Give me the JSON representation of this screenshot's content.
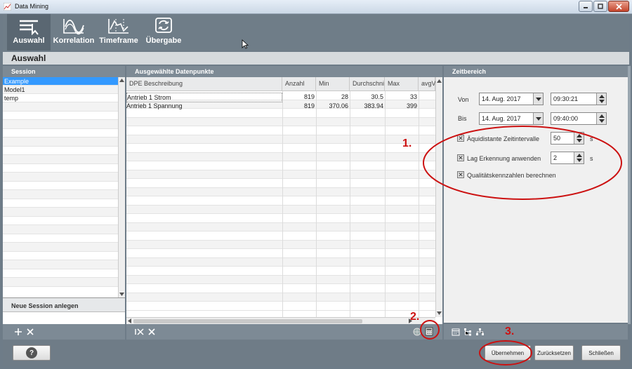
{
  "window": {
    "title": "Data Mining"
  },
  "toolbar": {
    "items": [
      {
        "label": "Auswahl"
      },
      {
        "label": "Korrelation"
      },
      {
        "label": "Timeframe"
      },
      {
        "label": "Übergabe"
      }
    ]
  },
  "section": {
    "title": "Auswahl"
  },
  "session": {
    "header": "Session",
    "items": [
      "Example",
      "Model1",
      "temp"
    ],
    "new_label": "Neue Session anlegen"
  },
  "datapoints": {
    "header": "Ausgewählte Datenpunkte",
    "columns": [
      "DPE Beschreibung",
      "Anzahl",
      "Min",
      "Durchschni",
      "Max",
      "avgV"
    ],
    "rows": [
      [
        "Antrieb 1 Strom",
        "819",
        "28",
        "30.5",
        "33"
      ],
      [
        "Antrieb 1 Spannung",
        "819",
        "370.06",
        "383.94",
        "399"
      ]
    ]
  },
  "zeitbereich": {
    "header": "Zeitbereich",
    "von_label": "Von",
    "bis_label": "Bis",
    "von_date": "14. Aug. 2017",
    "von_time": "09:30:21",
    "bis_date": "14. Aug. 2017",
    "bis_time": "09:40:00",
    "equidistant_label": "Äquidistante Zeitintervalle",
    "equidistant_value": "50",
    "lag_label": "Lag Erkennung anwenden",
    "lag_value": "2",
    "quality_label": "Qualitätskennzahlen berechnen",
    "unit_s": "s"
  },
  "annotations": {
    "a1": "1.",
    "a2": "2.",
    "a3": "3."
  },
  "buttons": {
    "help": "?",
    "apply": "Übernehmen",
    "reset": "Zurücksetzen",
    "close": "Schließen"
  },
  "colors": {
    "selection": "#3399ff",
    "annotation": "#cc1111",
    "toolbar": "#6f7d88"
  }
}
